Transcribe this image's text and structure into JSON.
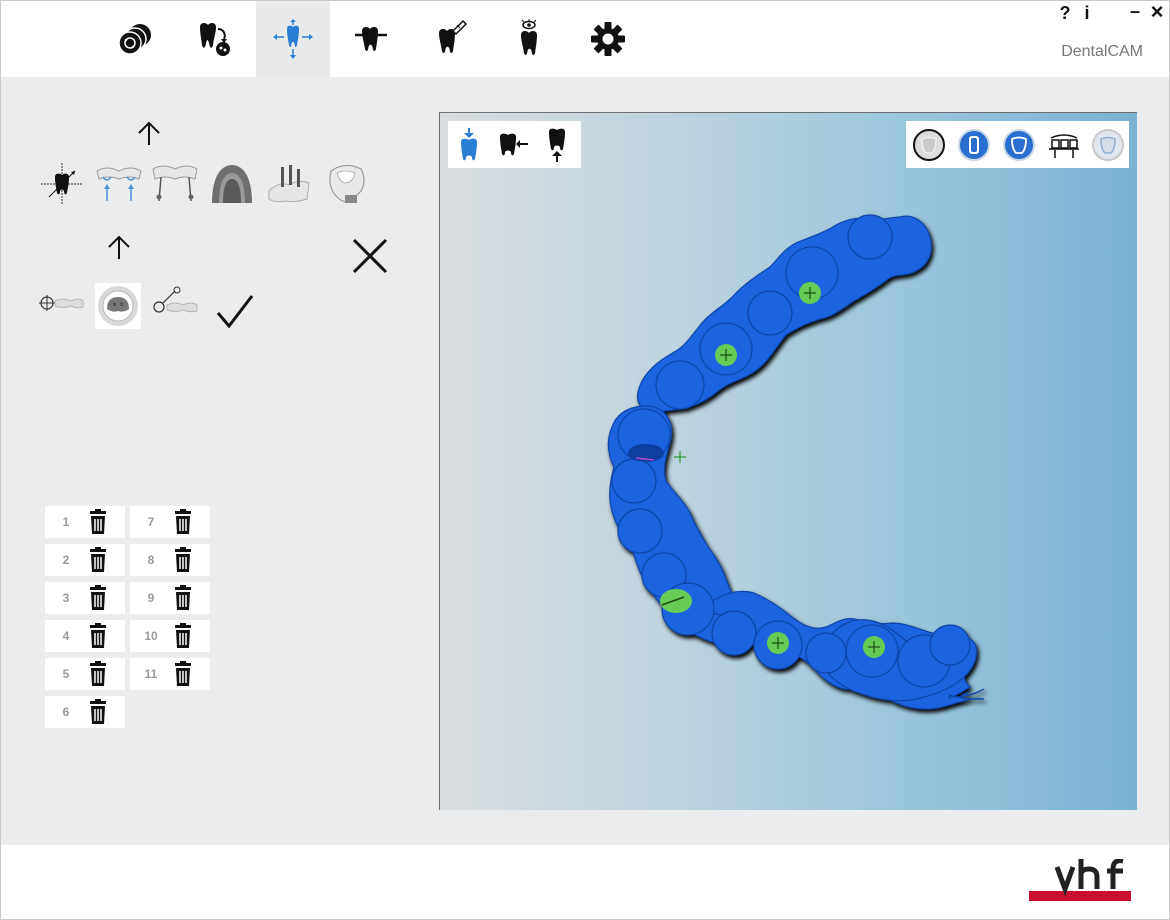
{
  "app": {
    "brand": "DentalCAM",
    "help_label": "?",
    "info_label": "i",
    "minimize_label": "–",
    "close_label": "×"
  },
  "toolbar": {
    "active_index": 2,
    "items": [
      {
        "icon": "disc-stack-icon"
      },
      {
        "icon": "tooth-import-icon"
      },
      {
        "icon": "tooth-position-icon"
      },
      {
        "icon": "tooth-attachment-icon"
      },
      {
        "icon": "tooth-calculate-icon"
      },
      {
        "icon": "tooth-preview-icon"
      },
      {
        "icon": "gear-icon"
      }
    ]
  },
  "left_panel": {
    "slots": [
      {
        "num": "1"
      },
      {
        "num": "2"
      },
      {
        "num": "3"
      },
      {
        "num": "4"
      },
      {
        "num": "5"
      },
      {
        "num": "6"
      },
      {
        "num": "7"
      },
      {
        "num": "8"
      },
      {
        "num": "9"
      },
      {
        "num": "10"
      },
      {
        "num": "11"
      }
    ]
  },
  "colors": {
    "accent": "#2a7fd4",
    "model_blue": "#1a64e0",
    "marker_green": "#66cc55",
    "brand_red": "#c8102e"
  }
}
